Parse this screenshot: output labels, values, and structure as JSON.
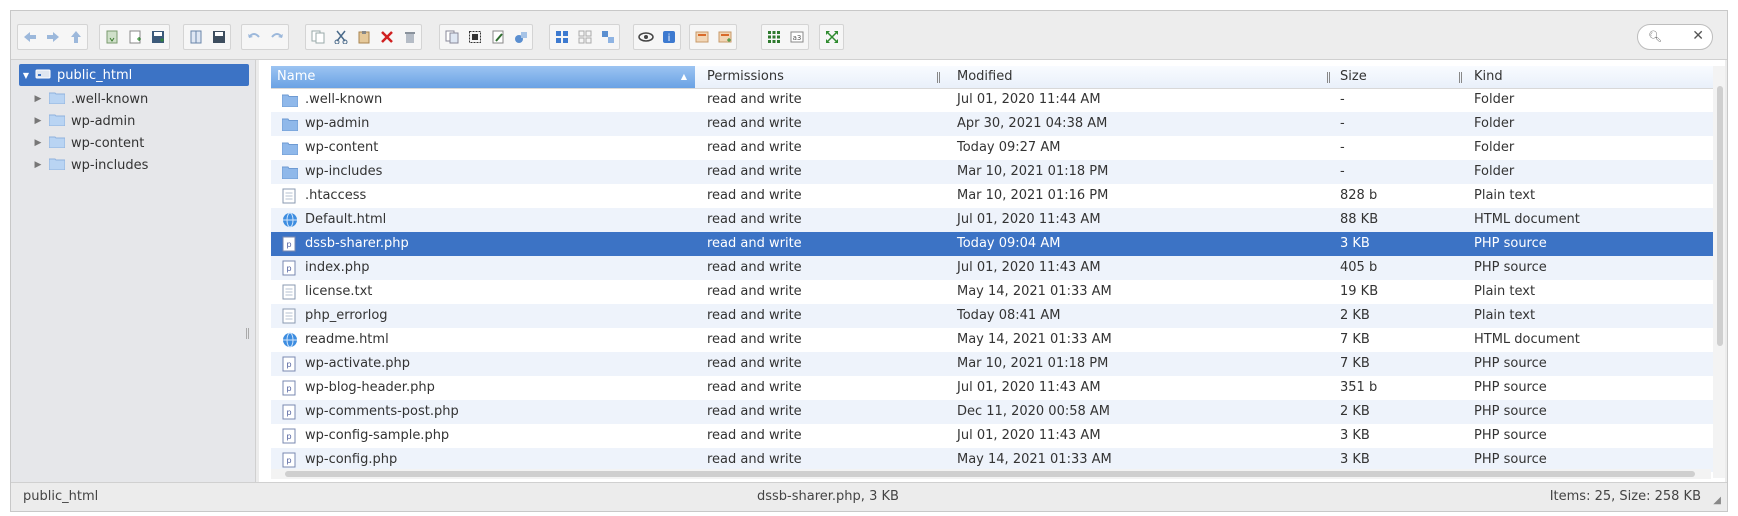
{
  "tree": {
    "root": "public_html",
    "items": [
      ".well-known",
      "wp-admin",
      "wp-content",
      "wp-includes"
    ]
  },
  "columns": {
    "name": "Name",
    "permissions": "Permissions",
    "modified": "Modified",
    "size": "Size",
    "kind": "Kind"
  },
  "files": [
    {
      "name": ".well-known",
      "icon": "folder-icon",
      "permissions": "read and write",
      "modified": "Jul 01, 2020 11:44 AM",
      "size": "-",
      "kind": "Folder"
    },
    {
      "name": "wp-admin",
      "icon": "folder-icon",
      "permissions": "read and write",
      "modified": "Apr 30, 2021 04:38 AM",
      "size": "-",
      "kind": "Folder"
    },
    {
      "name": "wp-content",
      "icon": "folder-icon",
      "permissions": "read and write",
      "modified": "Today 09:27 AM",
      "size": "-",
      "kind": "Folder"
    },
    {
      "name": "wp-includes",
      "icon": "folder-icon",
      "permissions": "read and write",
      "modified": "Mar 10, 2021 01:18 PM",
      "size": "-",
      "kind": "Folder"
    },
    {
      "name": ".htaccess",
      "icon": "text-file-icon",
      "permissions": "read and write",
      "modified": "Mar 10, 2021 01:16 PM",
      "size": "828 b",
      "kind": "Plain text"
    },
    {
      "name": "Default.html",
      "icon": "html-file-icon",
      "permissions": "read and write",
      "modified": "Jul 01, 2020 11:43 AM",
      "size": "88 KB",
      "kind": "HTML document"
    },
    {
      "name": "dssb-sharer.php",
      "icon": "php-file-icon",
      "permissions": "read and write",
      "modified": "Today 09:04 AM",
      "size": "3 KB",
      "kind": "PHP source",
      "selected": true
    },
    {
      "name": "index.php",
      "icon": "php-file-icon",
      "permissions": "read and write",
      "modified": "Jul 01, 2020 11:43 AM",
      "size": "405 b",
      "kind": "PHP source"
    },
    {
      "name": "license.txt",
      "icon": "text-file-icon",
      "permissions": "read and write",
      "modified": "May 14, 2021 01:33 AM",
      "size": "19 KB",
      "kind": "Plain text"
    },
    {
      "name": "php_errorlog",
      "icon": "text-file-icon",
      "permissions": "read and write",
      "modified": "Today 08:41 AM",
      "size": "2 KB",
      "kind": "Plain text"
    },
    {
      "name": "readme.html",
      "icon": "html-file-icon",
      "permissions": "read and write",
      "modified": "May 14, 2021 01:33 AM",
      "size": "7 KB",
      "kind": "HTML document"
    },
    {
      "name": "wp-activate.php",
      "icon": "php-file-icon",
      "permissions": "read and write",
      "modified": "Mar 10, 2021 01:18 PM",
      "size": "7 KB",
      "kind": "PHP source"
    },
    {
      "name": "wp-blog-header.php",
      "icon": "php-file-icon",
      "permissions": "read and write",
      "modified": "Jul 01, 2020 11:43 AM",
      "size": "351 b",
      "kind": "PHP source"
    },
    {
      "name": "wp-comments-post.php",
      "icon": "php-file-icon",
      "permissions": "read and write",
      "modified": "Dec 11, 2020 00:58 AM",
      "size": "2 KB",
      "kind": "PHP source"
    },
    {
      "name": "wp-config-sample.php",
      "icon": "php-file-icon",
      "permissions": "read and write",
      "modified": "Jul 01, 2020 11:43 AM",
      "size": "3 KB",
      "kind": "PHP source"
    },
    {
      "name": "wp-config.php",
      "icon": "php-file-icon",
      "permissions": "read and write",
      "modified": "May 14, 2021 01:33 AM",
      "size": "3 KB",
      "kind": "PHP source"
    }
  ],
  "status": {
    "path": "public_html",
    "selection": "dssb-sharer.php, 3 KB",
    "summary": "Items: 25, Size: 258 KB"
  },
  "colors": {
    "selection": "#3c73c5",
    "row_alt": "#eef3fb"
  }
}
